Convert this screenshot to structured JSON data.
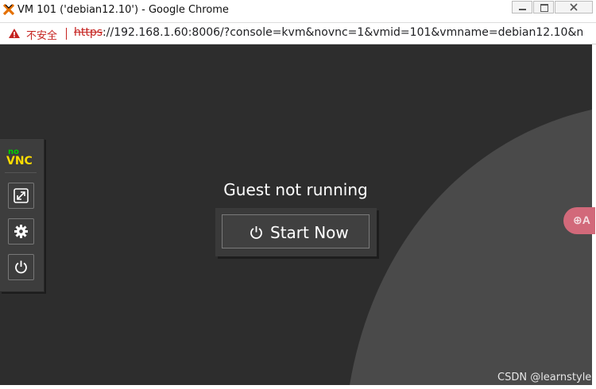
{
  "window": {
    "title": "VM 101 ('debian12.10') - Google Chrome"
  },
  "addressbar": {
    "insecure_label": "不安全",
    "url_scheme": "https",
    "url_rest": "://192.168.1.60:8006/?console=kvm&novnc=1&vmid=101&vmname=debian12.10&no..."
  },
  "sidebar": {
    "logo_top": "no",
    "logo_main": "VNC",
    "buttons": [
      {
        "icon": "fullscreen-icon"
      },
      {
        "icon": "gear-icon"
      },
      {
        "icon": "power-icon"
      }
    ]
  },
  "console": {
    "status_text": "Guest not running",
    "start_button_label": "Start Now"
  },
  "translate_bubble_text": "⊕A",
  "watermark": "CSDN @learnstyle",
  "colors": {
    "background_dark": "#2d2d2d",
    "background_swoosh": "#4a4a4a",
    "logo_green": "#00d000",
    "logo_yellow": "#ffdd00",
    "warning_red": "#c5221f",
    "translate_pink": "#d2697a"
  }
}
